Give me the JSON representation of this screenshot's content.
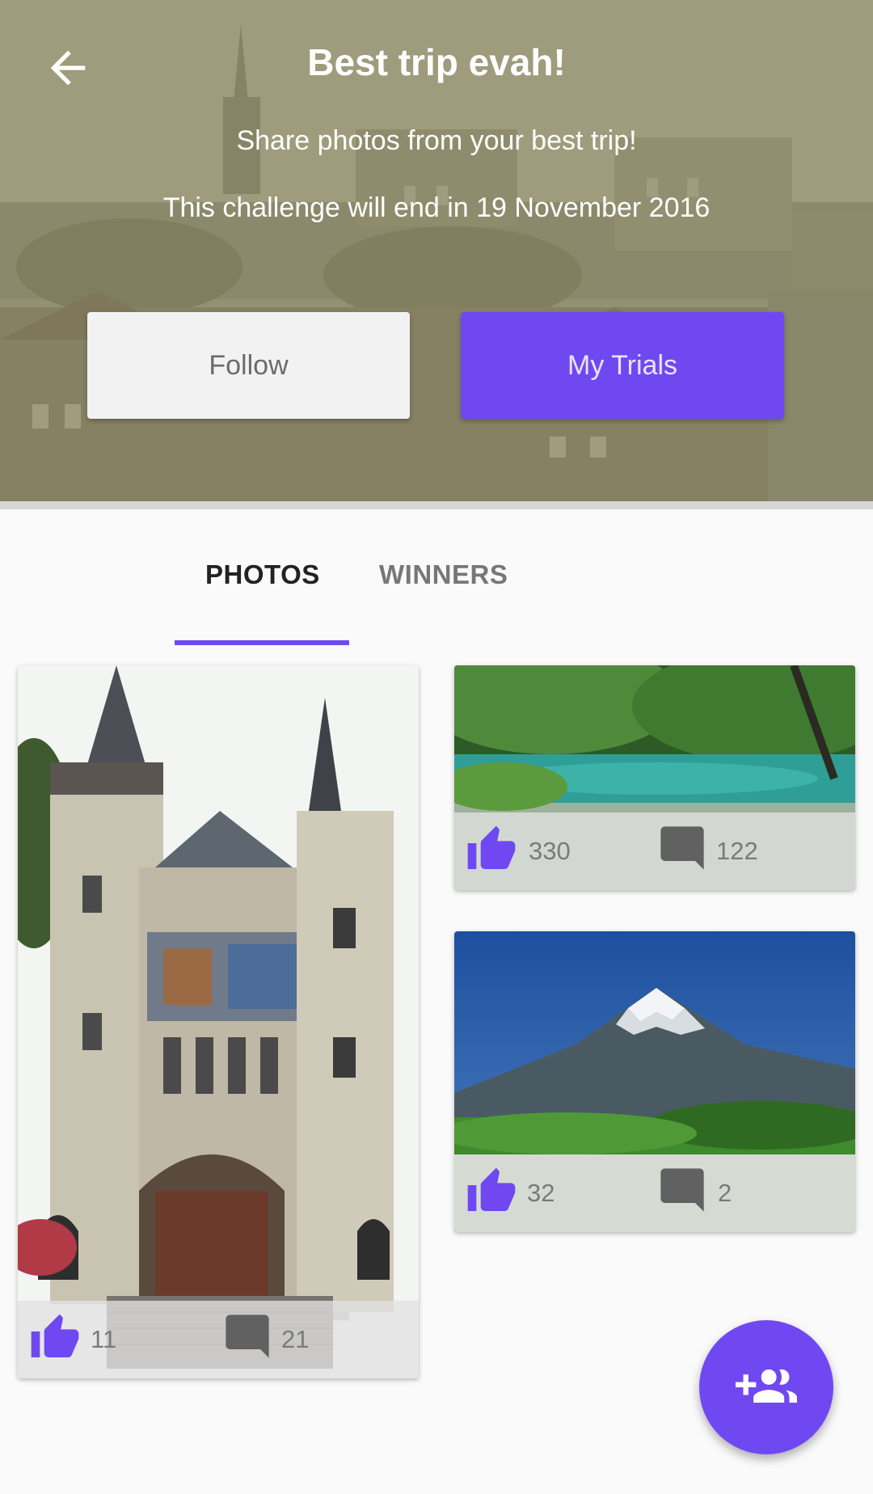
{
  "header": {
    "title": "Best trip evah!",
    "subtitle": "Share photos from your best trip!",
    "end_text": "This challenge will end in 19 November 2016",
    "follow_label": "Follow",
    "trials_label": "My Trials"
  },
  "tabs": [
    {
      "label": "PHOTOS",
      "selected": true
    },
    {
      "label": "WINNERS",
      "selected": false
    }
  ],
  "photos": [
    {
      "subject": "castle building",
      "likes": "11",
      "comments": "21"
    },
    {
      "subject": "turquoise lake in forest",
      "likes": "330",
      "comments": "122"
    },
    {
      "subject": "snow-capped mountain",
      "likes": "32",
      "comments": "2"
    }
  ],
  "icons": {
    "back": "arrow-back-icon",
    "like": "thumb-up-icon",
    "comment": "comment-icon",
    "fab": "group-add-icon"
  },
  "colors": {
    "accent": "#7048f2",
    "header_tint": "#8c8a64"
  }
}
